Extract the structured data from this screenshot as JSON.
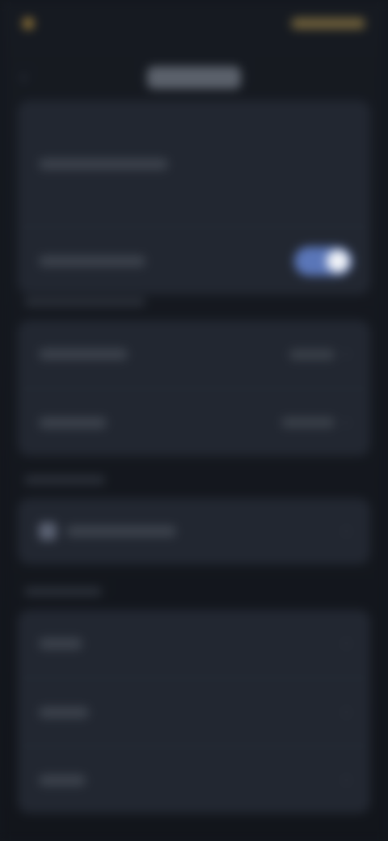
{
  "status_bar": {
    "time": "",
    "indicators": ""
  },
  "header": {
    "title": ""
  },
  "card1": {
    "items": [
      {
        "label": "",
        "value": ""
      },
      {
        "label": "",
        "toggle_on": true
      }
    ]
  },
  "section2": {
    "label": "",
    "items": [
      {
        "label": "",
        "value": ""
      },
      {
        "label": "",
        "value": ""
      }
    ]
  },
  "section3": {
    "label": "",
    "items": [
      {
        "label": "",
        "icon": "device-icon"
      }
    ]
  },
  "section4": {
    "label": "",
    "items": [
      {
        "label": ""
      },
      {
        "label": ""
      },
      {
        "label": ""
      }
    ]
  },
  "colors": {
    "background": "#14171d",
    "card": "#222731",
    "accent": "#5a76b8",
    "status_gold": "#9a7b3a"
  }
}
